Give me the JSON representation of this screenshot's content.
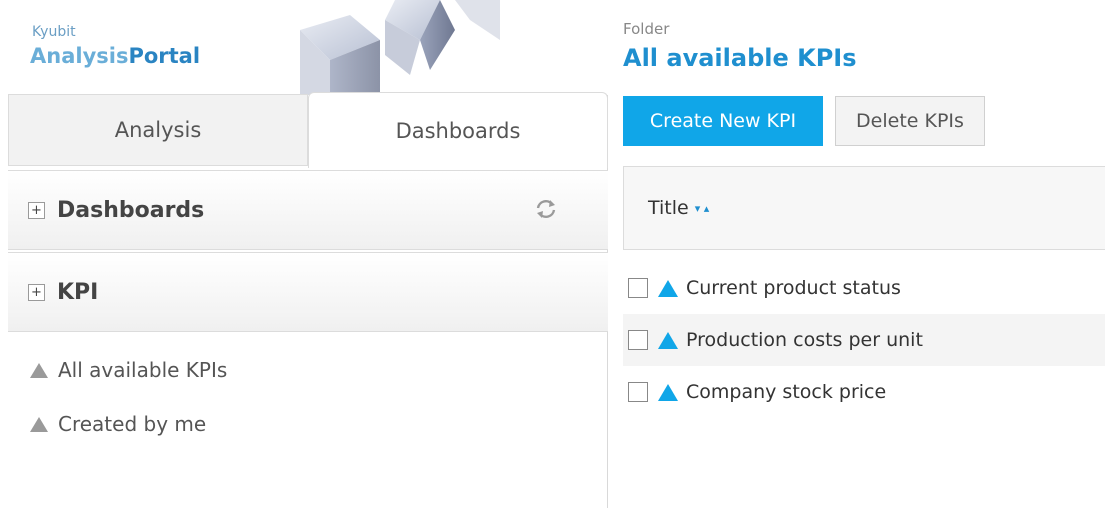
{
  "brand": {
    "top": "Kyubit",
    "main_a": "Analysis",
    "main_b": "Portal"
  },
  "tabs": [
    {
      "label": "Analysis",
      "active": false
    },
    {
      "label": "Dashboards",
      "active": true
    }
  ],
  "sections": {
    "dashboards": "Dashboards",
    "kpi": "KPI",
    "plus": "+"
  },
  "kpi_tree": [
    {
      "label": "All available KPIs"
    },
    {
      "label": "Created by me"
    }
  ],
  "folder": {
    "label": "Folder",
    "title": "All available KPIs"
  },
  "toolbar": {
    "create": "Create New KPI",
    "delete": "Delete KPIs"
  },
  "table": {
    "column_title": "Title",
    "sort_icons": "▾ ▴",
    "rows": [
      {
        "label": "Current product status"
      },
      {
        "label": "Production costs per unit"
      },
      {
        "label": "Company stock price"
      }
    ]
  },
  "colors": {
    "accent": "#10a6e8",
    "title_blue": "#1f8fcf",
    "triangle_gray": "#9a9a9a"
  },
  "icons": {
    "refresh": "refresh-icon",
    "kpi": "triangle-icon"
  }
}
